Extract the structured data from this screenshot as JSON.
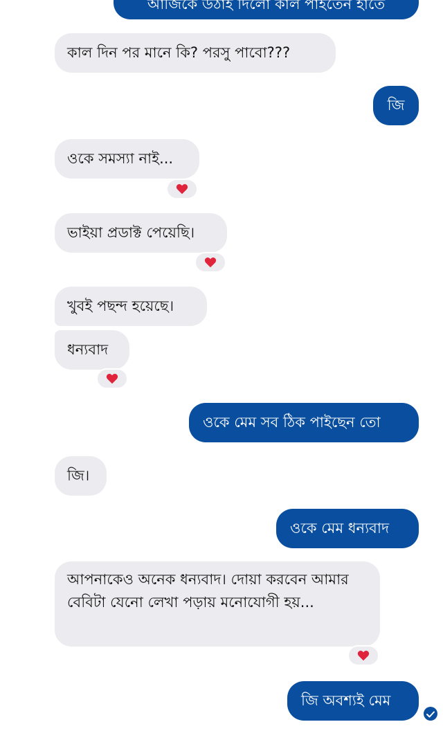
{
  "messages": {
    "m0": {
      "text": "আজিকে উঠাই দিলো কাল পাইতেন হাতে",
      "from": "me"
    },
    "m1": {
      "text": "কাল দিন পর মানে কি? পরসু পাবো???",
      "from": "them"
    },
    "m2": {
      "text": "জি",
      "from": "me"
    },
    "m3": {
      "text": "ওকে সমস্যা নাই...",
      "from": "them",
      "reaction": "heart"
    },
    "m4": {
      "text": "ভাইয়া প্রডাক্ট পেয়েছি।",
      "from": "them",
      "reaction": "heart"
    },
    "m5": {
      "text": "খুবই পছন্দ হয়েছে।",
      "from": "them"
    },
    "m6": {
      "text": "ধন্যবাদ",
      "from": "them",
      "reaction": "heart"
    },
    "m7": {
      "text": "ওকে মেম সব ঠিক পাইছেন তো",
      "from": "me"
    },
    "m8": {
      "text": "জি।",
      "from": "them"
    },
    "m9": {
      "text": "ওকে মেম ধন্যবাদ",
      "from": "me"
    },
    "m10": {
      "text": "আপনাকেও অনেক ধন্যবাদ। দোয়া করবেন আমার বেবিটা যেনো লেখা পড়ায় মনোযোগী হয়...",
      "from": "them",
      "reaction": "heart"
    },
    "m11": {
      "text": "জি অবশ্যই মেম",
      "from": "me",
      "status": "seen"
    }
  },
  "icons": {
    "reaction": "heart-icon",
    "status": "check-icon"
  },
  "colors": {
    "outgoing_bubble": "#0a4f9f",
    "incoming_bubble": "#ecebef",
    "heart": "#e0243b",
    "text_dark": "#111111",
    "text_light": "#ffffff"
  }
}
